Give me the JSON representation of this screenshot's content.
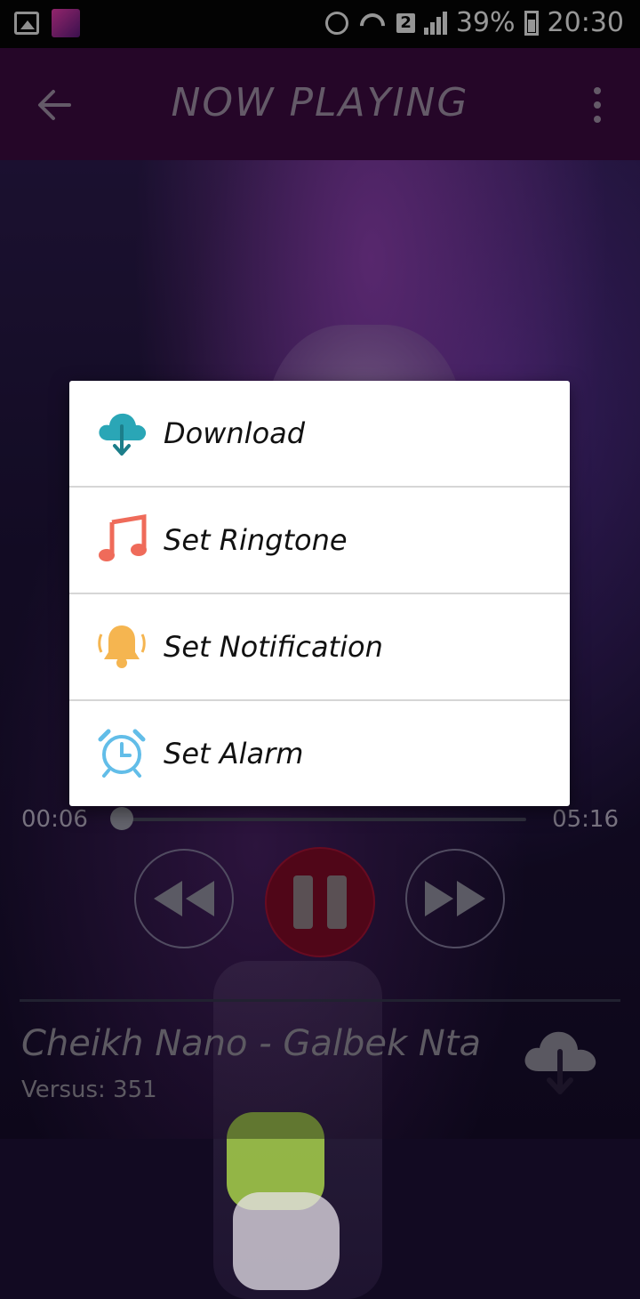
{
  "status_bar": {
    "sim_slot": "2",
    "battery": "39%",
    "time": "20:30"
  },
  "app_bar": {
    "title": "NOW PLAYING"
  },
  "dialog": {
    "items": [
      {
        "label": "Download",
        "icon": "cloud-download-icon",
        "color": "#2aa6b6"
      },
      {
        "label": "Set Ringtone",
        "icon": "music-note-icon",
        "color": "#ef6b5a"
      },
      {
        "label": "Set Notification",
        "icon": "bell-icon",
        "color": "#f5b550"
      },
      {
        "label": "Set Alarm",
        "icon": "alarm-clock-icon",
        "color": "#62bde8"
      }
    ]
  },
  "player": {
    "current_time": "00:06",
    "total_time": "05:16",
    "progress": 0.02,
    "song_title": "Cheikh Nano - Galbek Nta",
    "versus_label": "Versus: 351"
  },
  "colors": {
    "app_bar": "#3a0a3e",
    "pause_button": "#7c0a26"
  }
}
